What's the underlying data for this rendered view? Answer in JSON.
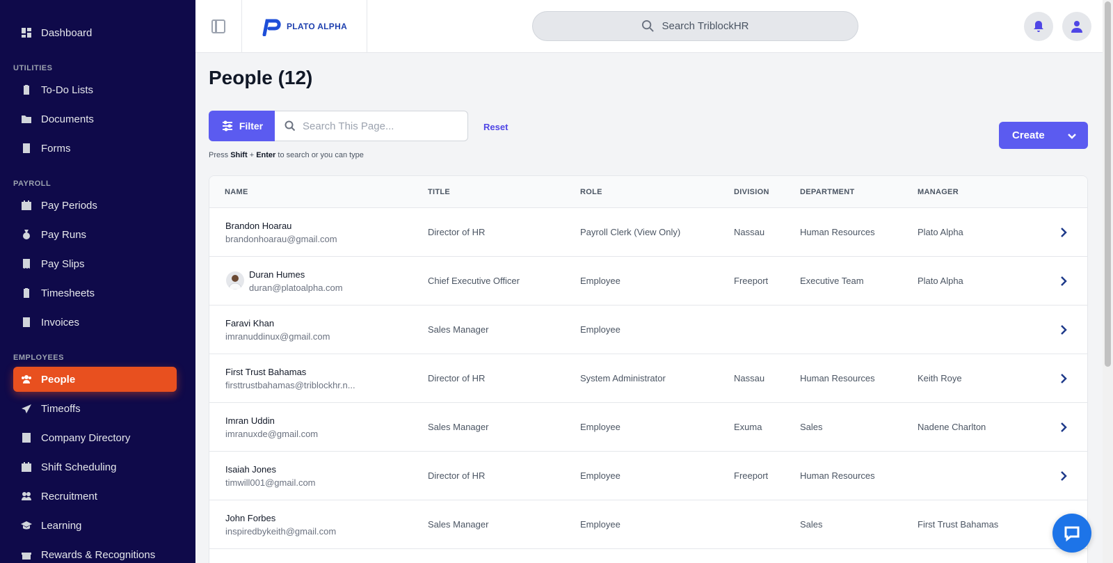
{
  "sidebar": {
    "dashboard": "Dashboard",
    "sections": {
      "utilities": "UTILITIES",
      "payroll": "PAYROLL",
      "employees": "EMPLOYEES"
    },
    "utilities": [
      "To-Do Lists",
      "Documents",
      "Forms"
    ],
    "payroll": [
      "Pay Periods",
      "Pay Runs",
      "Pay Slips",
      "Timesheets",
      "Invoices"
    ],
    "employees": [
      "People",
      "Timeoffs",
      "Company Directory",
      "Shift Scheduling",
      "Recruitment",
      "Learning",
      "Rewards & Recognitions"
    ],
    "active_item": "People",
    "active_color": "#e8501f",
    "bg_color": "#0f0a4a"
  },
  "topbar": {
    "brand": "PLATO ALPHA",
    "search_placeholder": "Search TriblockHR"
  },
  "main": {
    "title": "People (12)",
    "filter_label": "Filter",
    "search_placeholder": "Search This Page...",
    "reset_label": "Reset",
    "hint_prefix": "Press",
    "hint_key1": "Shift",
    "hint_plus": "+",
    "hint_key2": "Enter",
    "hint_suffix": "to search or you can type",
    "create_label": "Create",
    "accent_color": "#5b5bf0"
  },
  "table": {
    "headers": {
      "name": "NAME",
      "title": "TITLE",
      "role": "ROLE",
      "division": "DIVISION",
      "department": "DEPARTMENT",
      "manager": "MANAGER"
    },
    "rows": [
      {
        "name": "Brandon Hoarau",
        "email": "brandonhoarau@gmail.com",
        "title": "Director of HR",
        "role": "Payroll Clerk (View Only)",
        "division": "Nassau",
        "department": "Human Resources",
        "manager": "Plato Alpha"
      },
      {
        "name": "Duran Humes",
        "email": "duran@platoalpha.com",
        "title": "Chief Executive Officer",
        "role": "Employee",
        "division": "Freeport",
        "department": "Executive Team",
        "manager": "Plato Alpha"
      },
      {
        "name": "Faravi Khan",
        "email": "imranuddinux@gmail.com",
        "title": "Sales Manager",
        "role": "Employee",
        "division": "",
        "department": "",
        "manager": ""
      },
      {
        "name": "First Trust Bahamas",
        "email": "firsttrustbahamas@triblockhr.n...",
        "title": "Director of HR",
        "role": "System Administrator",
        "division": "Nassau",
        "department": "Human Resources",
        "manager": "Keith Roye"
      },
      {
        "name": "Imran Uddin",
        "email": "imranuxde@gmail.com",
        "title": "Sales Manager",
        "role": "Employee",
        "division": "Exuma",
        "department": "Sales",
        "manager": "Nadene Charlton"
      },
      {
        "name": "Isaiah Jones",
        "email": "timwill001@gmail.com",
        "title": "Director of HR",
        "role": "Employee",
        "division": "Freeport",
        "department": "Human Resources",
        "manager": ""
      },
      {
        "name": "John Forbes",
        "email": "inspiredbykeith@gmail.com",
        "title": "Sales Manager",
        "role": "Employee",
        "division": "",
        "department": "Sales",
        "manager": "First Trust Bahamas"
      }
    ]
  }
}
